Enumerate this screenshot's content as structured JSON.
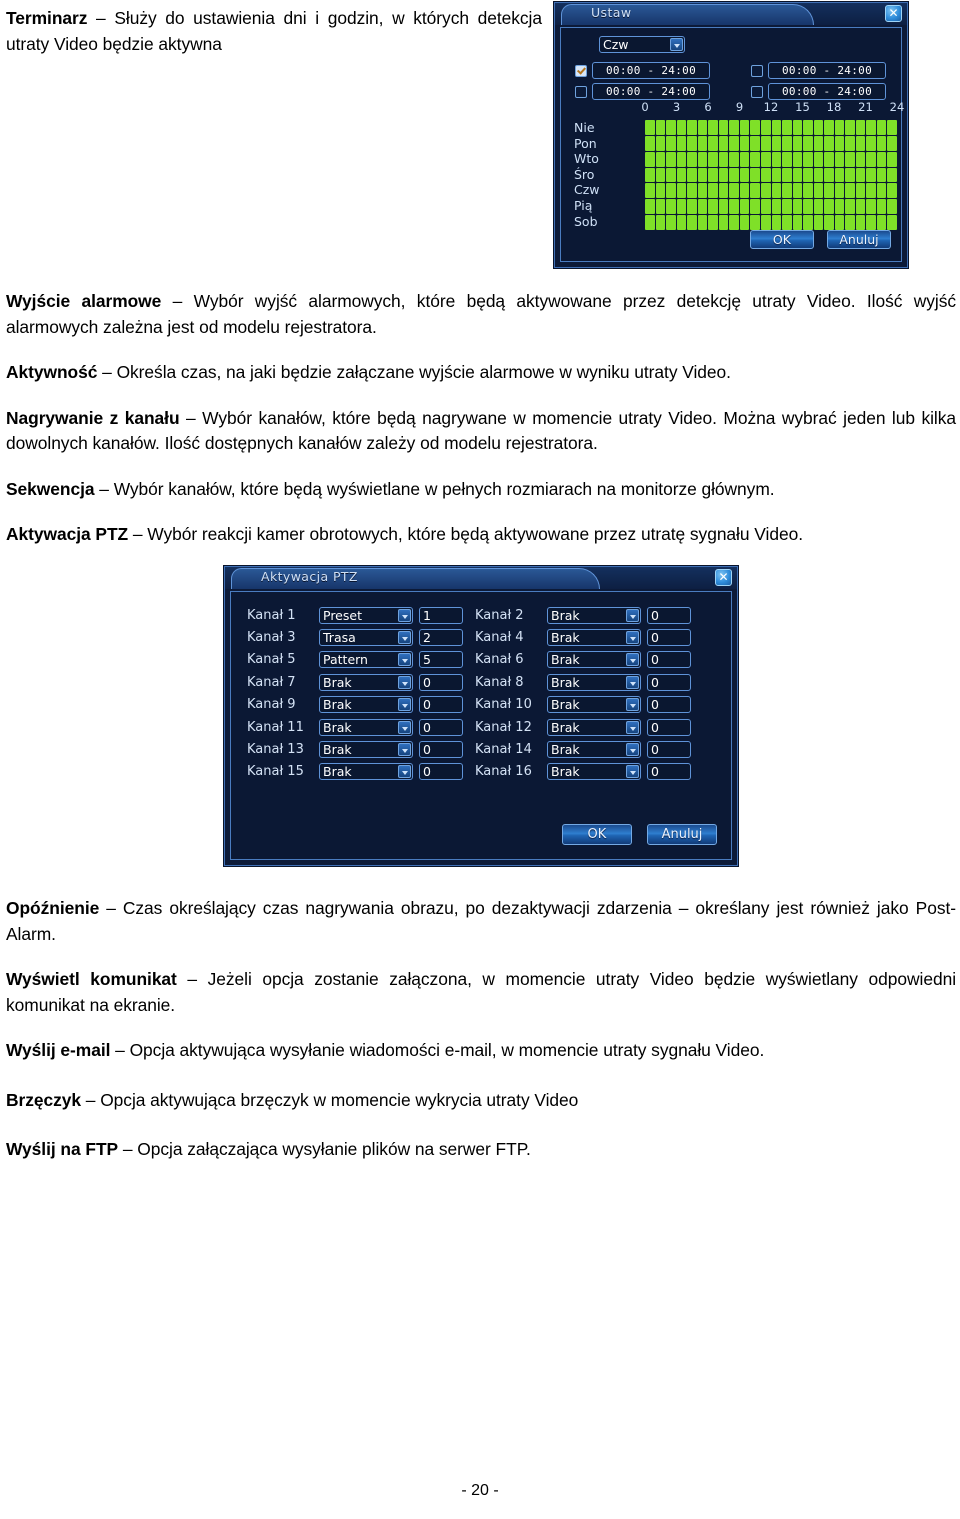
{
  "page": {
    "number_label": "- 20 -"
  },
  "paragraphs": [
    {
      "id": "terminarz",
      "term": "Terminarz",
      "dash": " – ",
      "text": "Służy do ustawienia dni i godzin, w których detekcja utraty Video będzie aktywna"
    },
    {
      "id": "wyjscie-alarmowe",
      "term": "Wyjście alarmowe",
      "dash": " – ",
      "text": "Wybór wyjść alarmowych, które będą aktywowane przez detekcję utraty Video. Ilość wyjść alarmowych zależna jest od modelu rejestratora."
    },
    {
      "id": "aktywnosc",
      "term": "Aktywność",
      "dash": " – ",
      "text": "Określa czas, na jaki będzie załączane wyjście alarmowe w wyniku utraty Video."
    },
    {
      "id": "nagrywanie-z-kanalu",
      "term": "Nagrywanie z kanału",
      "dash": " – ",
      "text": "Wybór kanałów, które będą nagrywane w momencie utraty Video. Można wybrać jeden lub kilka dowolnych kanałów. Ilość dostępnych kanałów zależy od modelu rejestratora."
    },
    {
      "id": "sekwencja",
      "term": "Sekwencja",
      "dash": " – ",
      "text": "Wybór kanałów, które będą wyświetlane w pełnych rozmiarach na monitorze głównym."
    },
    {
      "id": "aktywacja-ptz",
      "term": "Aktywacja PTZ",
      "dash": " – ",
      "text": "Wybór reakcji kamer obrotowych, które będą aktywowane przez utratę sygnału Video."
    },
    {
      "id": "opoznienie",
      "term": "Opóźnienie",
      "dash": " – ",
      "text": "Czas określający czas nagrywania obrazu, po dezaktywacji zdarzenia – określany jest również jako Post-Alarm."
    },
    {
      "id": "wyswietl-komunikat",
      "term": "Wyświetl komunikat",
      "dash": " – ",
      "text": "Jeżeli opcja zostanie załączona, w momencie utraty Video będzie wyświetlany odpowiedni komunikat na ekranie."
    },
    {
      "id": "wyslij-email",
      "term": "Wyślij e-mail",
      "dash": " – ",
      "text": "Opcja aktywująca wysyłanie wiadomości e-mail, w momencie utraty sygnału Video."
    },
    {
      "id": "brzeczyk",
      "term": "Brzęczyk",
      "dash": " – ",
      "text": "Opcja aktywująca brzęczyk w momencie wykrycia utraty Video"
    },
    {
      "id": "wyslij-na-ftp",
      "term": "Wyślij na FTP",
      "dash": " – ",
      "text": "Opcja załączająca wysyłanie plików na serwer FTP."
    }
  ],
  "schedule_dialog": {
    "title": "Ustaw",
    "close_glyph": "✕",
    "day_select": "Czw",
    "periods": [
      {
        "checked": true,
        "value": "00:00  -  24:00"
      },
      {
        "checked": false,
        "value": "00:00  -  24:00"
      },
      {
        "checked": false,
        "value": "00:00  -  24:00"
      },
      {
        "checked": false,
        "value": "00:00  -  24:00"
      }
    ],
    "axis_ticks": [
      "0",
      "3",
      "6",
      "9",
      "12",
      "15",
      "18",
      "21",
      "24"
    ],
    "day_labels": [
      "Nie",
      "Pon",
      "Wto",
      "Śro",
      "Czw",
      "Pią",
      "Sob"
    ],
    "grid": {
      "columns": 24,
      "rows": 7,
      "active_color": "#7FE028",
      "all_active": true
    },
    "ok_label": "OK",
    "cancel_label": "Anuluj"
  },
  "ptz_dialog": {
    "title": "Aktywacja PTZ",
    "close_glyph": "✕",
    "rows": [
      {
        "left_label": "Kanał 1",
        "left_mode": "Preset",
        "left_value": "1",
        "right_label": "Kanał 2",
        "right_mode": "Brak",
        "right_value": "0"
      },
      {
        "left_label": "Kanał 3",
        "left_mode": "Trasa",
        "left_value": "2",
        "right_label": "Kanał 4",
        "right_mode": "Brak",
        "right_value": "0"
      },
      {
        "left_label": "Kanał 5",
        "left_mode": "Pattern",
        "left_value": "5",
        "right_label": "Kanał 6",
        "right_mode": "Brak",
        "right_value": "0"
      },
      {
        "left_label": "Kanał 7",
        "left_mode": "Brak",
        "left_value": "0",
        "right_label": "Kanał 8",
        "right_mode": "Brak",
        "right_value": "0"
      },
      {
        "left_label": "Kanał 9",
        "left_mode": "Brak",
        "left_value": "0",
        "right_label": "Kanał 10",
        "right_mode": "Brak",
        "right_value": "0"
      },
      {
        "left_label": "Kanał 11",
        "left_mode": "Brak",
        "left_value": "0",
        "right_label": "Kanał 12",
        "right_mode": "Brak",
        "right_value": "0"
      },
      {
        "left_label": "Kanał 13",
        "left_mode": "Brak",
        "left_value": "0",
        "right_label": "Kanał 14",
        "right_mode": "Brak",
        "right_value": "0"
      },
      {
        "left_label": "Kanał 15",
        "left_mode": "Brak",
        "left_value": "0",
        "right_label": "Kanał 16",
        "right_mode": "Brak",
        "right_value": "0"
      }
    ],
    "ok_label": "OK",
    "cancel_label": "Anuluj"
  },
  "colors": {
    "dialog_bg": "#0C1A38",
    "dialog_border": "#3F6FB5",
    "accent_blue": "#2F7FD0",
    "grid_green": "#7FE028",
    "text_light": "#D8E4F4"
  }
}
